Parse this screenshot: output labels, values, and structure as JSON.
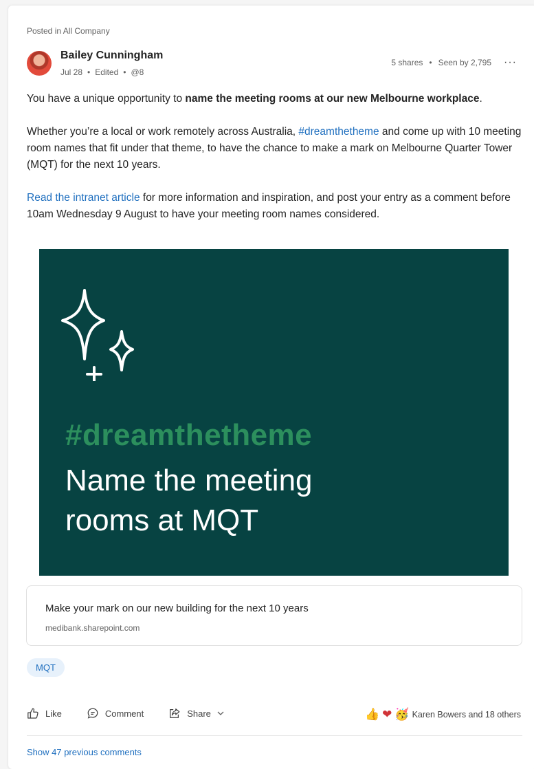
{
  "post": {
    "posted_in": "Posted in All Company",
    "author": "Bailey Cunningham",
    "date": "Jul 28",
    "edited": "Edited",
    "mention_count": "@8",
    "shares": "5 shares",
    "seen_by": "Seen by 2,795",
    "more_label": "···",
    "p1_before": "You have a unique opportunity to ",
    "p1_bold": "name the meeting rooms at our new Melbourne workplace",
    "p1_after": ".",
    "p2_before": "Whether you’re a local or work remotely across Australia, ",
    "p2_hashtag": "#dreamthetheme",
    "p2_after": " and come up with 10 meeting room names that fit under that theme, to have the chance to make a mark on Melbourne Quarter Tower (MQT) for the next 10 years.",
    "p3_link": "Read the intranet article",
    "p3_after": " for more information and inspiration, and post your entry as a comment before 10am Wednesday 9 August to have your meeting room names considered."
  },
  "banner": {
    "hashtag": "#dreamthetheme",
    "headline_line1": "Name the meeting",
    "headline_line2": "rooms at MQT",
    "bg_color": "#074342",
    "hashtag_color": "#2c8f5d",
    "icon": "sparkles-icon"
  },
  "link_preview": {
    "title": "Make your mark on our new building for the next 10 years",
    "domain": "medibank.sharepoint.com"
  },
  "topic": "MQT",
  "actions": {
    "like": "Like",
    "comment": "Comment",
    "share": "Share",
    "reactors": "Karen Bowers and 18 others"
  },
  "comments": {
    "show_previous": "Show 47 previous comments"
  },
  "colors": {
    "link": "#1f6fbf",
    "text": "#242424",
    "muted": "#616161"
  }
}
